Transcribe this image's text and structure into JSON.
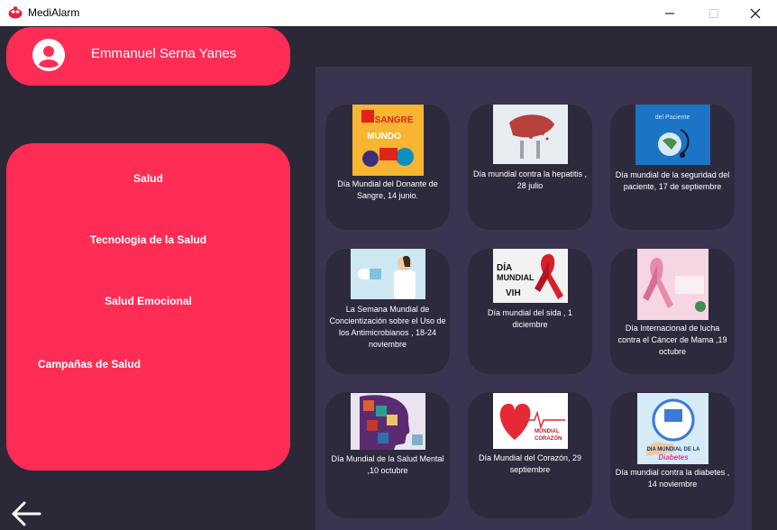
{
  "window": {
    "title": "MediAlarm",
    "minimize": "—",
    "maximize": "☐",
    "close": "✕"
  },
  "user": {
    "name": "Emmanuel Serna Yanes",
    "icon": "user-avatar-icon"
  },
  "menu": {
    "items": [
      {
        "label": "Salud"
      },
      {
        "label": "Tecnologia de la Salud"
      },
      {
        "label": "Salud Emocional"
      },
      {
        "label": "Campañas de Salud"
      }
    ]
  },
  "back": {
    "icon": "arrow-left-icon"
  },
  "campaigns": [
    {
      "title": "Día Mundial del Donante de Sangre, 14 junio.",
      "poster": {
        "top": "SANGRE",
        "bottom": "MUNDO"
      }
    },
    {
      "title": "Día mundial contra la hepatitis , 28 julio"
    },
    {
      "title": "Día mundial de la seguridad del paciente, 17 de septiembre",
      "poster": {
        "top": "del Paciente"
      }
    },
    {
      "title": "La Semana Mundial de Concientización sobre el Uso de los Antimicrobianos , 18-24 noviembre"
    },
    {
      "title": "Día mundial del sida , 1 diciembre",
      "poster": {
        "line1": "DÍA",
        "line2": "MUNDIAL",
        "line3": "VIH"
      }
    },
    {
      "title": "Día Internacional de lucha contra el  Cáncer de Mama ,19 octubre"
    },
    {
      "title": "Día Mundial de la Salud Mental ,10 octubre"
    },
    {
      "title": "Día Mundial del Corazón, 29 septiembre",
      "poster": {
        "line1": "MUNDIAL",
        "line2": "CORAZÓN"
      }
    },
    {
      "title": "Día mundial contra la diabetes , 14 noviembre",
      "poster": {
        "line1": "DIA MUNDIAL DE LA",
        "line2": "Diabetes"
      }
    }
  ],
  "colors": {
    "accent": "#ff2d55",
    "background": "#2b2838",
    "panel": "#3b3450",
    "card": "#2e2a3d"
  }
}
